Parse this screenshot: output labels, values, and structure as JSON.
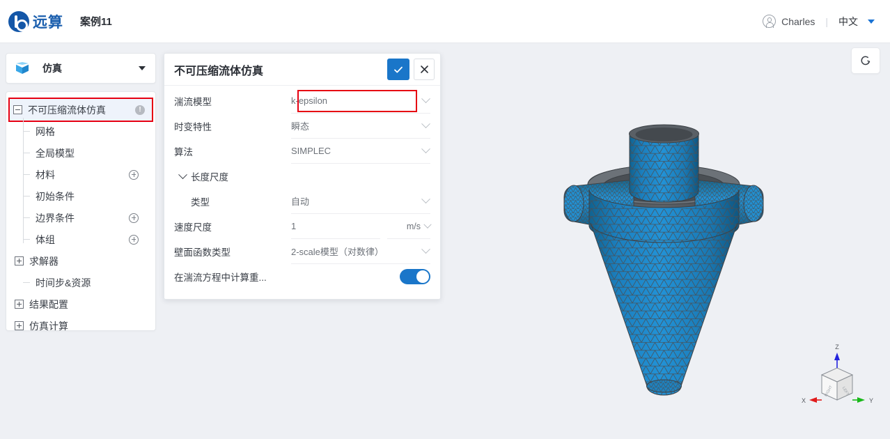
{
  "header": {
    "logo_text": "远算",
    "logo_icon": "yuansuan-logo-icon",
    "project_title": "案例11",
    "user_name": "Charles",
    "user_icon": "user-circle-icon",
    "separator": "|",
    "language": "中文",
    "language_caret": "chevron-down-icon"
  },
  "sidebar": {
    "header": {
      "icon": "cube-icon",
      "label": "仿真",
      "caret": "chevron-down-icon"
    },
    "tree": {
      "root": {
        "label": "不可压缩流体仿真",
        "expander": "collapse-minus-icon",
        "badge_icon": "info-circle-icon",
        "badge_char": "!",
        "highlighted": true
      },
      "items": [
        {
          "label": "网格",
          "type": "leaf",
          "add": false
        },
        {
          "label": "全局模型",
          "type": "leaf",
          "add": false
        },
        {
          "label": "材料",
          "type": "leaf",
          "add": true
        },
        {
          "label": "初始条件",
          "type": "leaf",
          "add": false
        },
        {
          "label": "边界条件",
          "type": "leaf",
          "add": true
        },
        {
          "label": "体组",
          "type": "leaf",
          "add": true
        },
        {
          "label": "求解器",
          "type": "node",
          "add": false
        },
        {
          "label": "时间步&资源",
          "type": "leaf",
          "add": false
        },
        {
          "label": "结果配置",
          "type": "node",
          "add": false
        },
        {
          "label": "仿真计算",
          "type": "node",
          "add": false
        }
      ]
    }
  },
  "dialog": {
    "title": "不可压缩流体仿真",
    "confirm_icon": "check-icon",
    "close_icon": "close-x-icon",
    "fields": [
      {
        "label": "湍流模型",
        "value": "k-epsilon",
        "control": "select",
        "highlight": true
      },
      {
        "label": "时变特性",
        "value": "瞬态",
        "control": "select"
      },
      {
        "label": "算法",
        "value": "SIMPLEC",
        "control": "select"
      },
      {
        "label": "长度尺度",
        "value": "",
        "control": "group"
      },
      {
        "label": "类型",
        "value": "自动",
        "control": "select",
        "indent": 2
      },
      {
        "label": "速度尺度",
        "value": "1",
        "control": "input-unit",
        "unit": "m/s"
      },
      {
        "label": "壁面函数类型",
        "value": "2-scale模型（对数律）",
        "control": "select"
      },
      {
        "label": "在湍流方程中计算重...",
        "value": "on",
        "control": "toggle"
      }
    ]
  },
  "viewport": {
    "reset_button_icon": "refresh-rotate-icon",
    "model_name": "cyclone-separator-mesh",
    "mesh_fill_color": "#1b7fbe",
    "mesh_wire_color": "#4a4f55",
    "background_color": "#eef0f4",
    "axis_widget": {
      "x_label": "X",
      "y_label": "Y",
      "z_label": "Z",
      "x_color": "#e01b1b",
      "y_color": "#18b818",
      "z_color": "#2323dd",
      "face_left_label": "LEFT",
      "face_right_label": "RIGHT"
    }
  }
}
